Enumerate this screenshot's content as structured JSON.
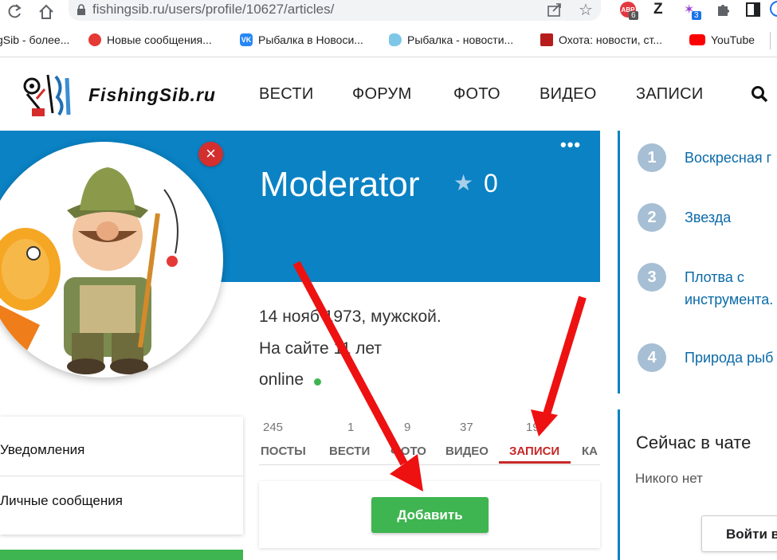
{
  "browser": {
    "url": "fishingsib.ru/users/profile/10627/articles/",
    "ext_abp_badge": "6",
    "ext_z": "Z",
    "ext_badge2": "3"
  },
  "bookmarks": [
    {
      "label": "gSib - более..."
    },
    {
      "label": "Новые сообщения..."
    },
    {
      "label": "Рыбалка в Новоси..."
    },
    {
      "label": "Рыбалка - новости..."
    },
    {
      "label": "Охота: новости, ст..."
    },
    {
      "label": "YouTube"
    }
  ],
  "site": {
    "logo_text": "FishingSib.ru",
    "nav": [
      "ВЕСТИ",
      "ФОРУМ",
      "ФОТО",
      "ВИДЕО",
      "ЗАПИСИ"
    ]
  },
  "profile": {
    "name": "Moderator",
    "rating": "0",
    "birth": "14 нояб 1973, мужской.",
    "on_site": "На сайте 11 лет",
    "status": "online"
  },
  "tabs": [
    {
      "count": "245",
      "label": "ПОСТЫ"
    },
    {
      "count": "1",
      "label": "ВЕСТИ"
    },
    {
      "count": "9",
      "label": "ФОТО"
    },
    {
      "count": "37",
      "label": "ВИДЕО"
    },
    {
      "count": "19",
      "label": "ЗАПИСИ"
    },
    {
      "count": "",
      "label": "КА"
    }
  ],
  "left_menu": {
    "notifications": "Уведомления",
    "messages": "Личные сообщения"
  },
  "add_button": "Добавить",
  "top_list": [
    {
      "n": "1",
      "text": "Воскресная г"
    },
    {
      "n": "2",
      "text": "Звезда"
    },
    {
      "n": "3",
      "text": "Плотва с инструмента."
    },
    {
      "n": "4",
      "text": "Природа рыб"
    }
  ],
  "chat": {
    "title": "Сейчас в чате",
    "empty": "Никого нет",
    "login": "Войти в"
  },
  "colors": {
    "accent": "#0a82c4",
    "green": "#3eb550",
    "arrow": "#ee1111"
  }
}
